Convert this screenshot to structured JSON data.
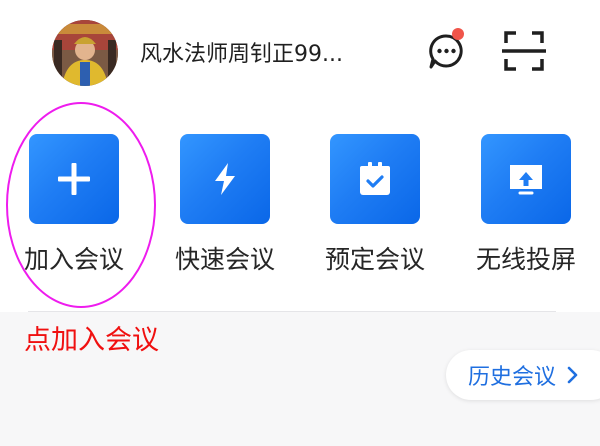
{
  "header": {
    "username": "风水法师周钊正99...",
    "avatar_icon": "user-avatar-photo",
    "message_icon": "chat-bubble-ellipsis-icon",
    "message_badge_color": "#f0554a",
    "scan_icon": "scan-frame-icon"
  },
  "actions": [
    {
      "label": "加入会议",
      "icon": "plus-icon"
    },
    {
      "label": "快速会议",
      "icon": "lightning-icon"
    },
    {
      "label": "预定会议",
      "icon": "calendar-check-icon"
    },
    {
      "label": "无线投屏",
      "icon": "screen-cast-icon"
    }
  ],
  "colors": {
    "tile_blue": "#1f7df4",
    "annotation_red": "#f01010",
    "highlight_magenta": "#ee1cee",
    "link_blue": "#1f6fe0"
  },
  "annotation": {
    "text": "点加入会议"
  },
  "history": {
    "label": "历史会议"
  }
}
